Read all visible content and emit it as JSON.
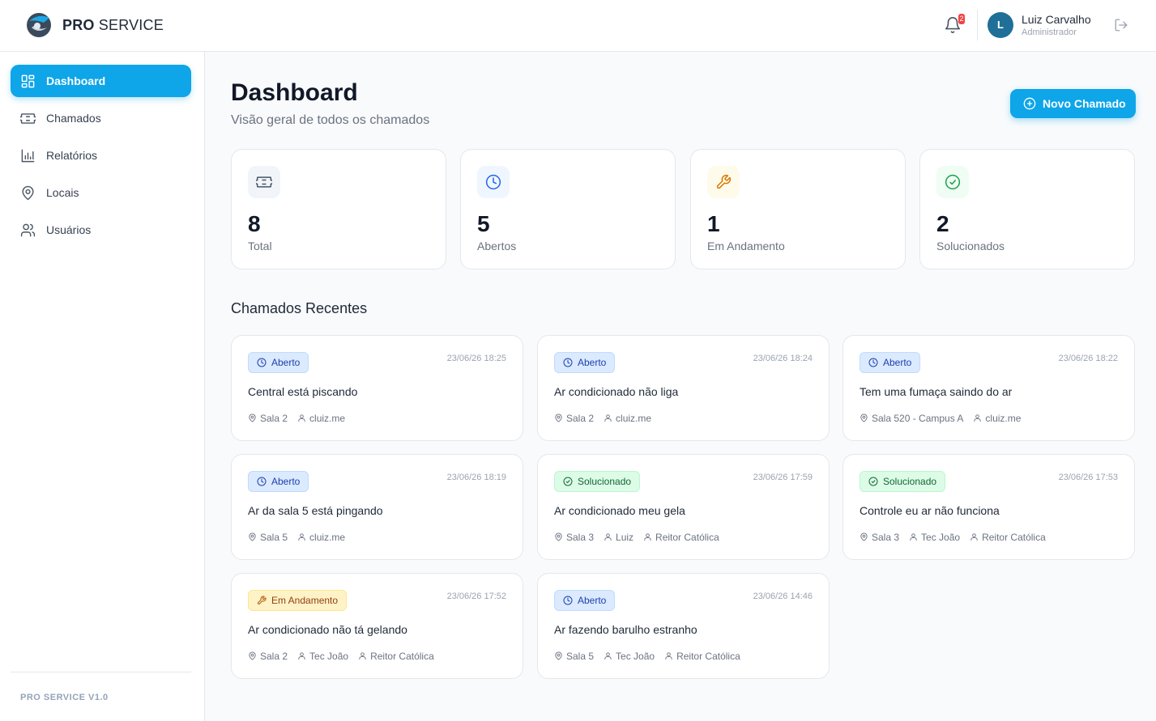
{
  "header": {
    "brand_bold": "PRO",
    "brand_rest": " SERVICE",
    "notification_count": "2",
    "user": {
      "initial": "L",
      "name": "Luiz Carvalho",
      "role": "Administrador"
    }
  },
  "sidebar": {
    "items": [
      {
        "label": "Dashboard",
        "icon": "grid-icon",
        "active": true
      },
      {
        "label": "Chamados",
        "icon": "ticket-icon"
      },
      {
        "label": "Relatórios",
        "icon": "bar-chart-icon"
      },
      {
        "label": "Locais",
        "icon": "map-pin-icon"
      },
      {
        "label": "Usuários",
        "icon": "users-icon"
      }
    ],
    "version": "PRO SERVICE V1.0"
  },
  "main": {
    "title": "Dashboard",
    "subtitle": "Visão geral de todos os chamados",
    "new_button": "Novo Chamado",
    "stats": [
      {
        "value": "8",
        "label": "Total",
        "icon": "ticket-icon",
        "color": "#475569"
      },
      {
        "value": "5",
        "label": "Abertos",
        "icon": "clock-icon",
        "color": "#2563eb"
      },
      {
        "value": "1",
        "label": "Em Andamento",
        "icon": "wrench-icon",
        "color": "#d97706"
      },
      {
        "value": "2",
        "label": "Solucionados",
        "icon": "check-circle-icon",
        "color": "#16a34a"
      }
    ],
    "recent_title": "Chamados Recentes",
    "tickets": [
      {
        "status": "Aberto",
        "date": "23/06/26 18:25",
        "title": "Central está piscando",
        "location": "Sala 2",
        "user": "cluiz.me",
        "tech": ""
      },
      {
        "status": "Aberto",
        "date": "23/06/26 18:24",
        "title": "Ar condicionado não liga",
        "location": "Sala 2",
        "user": "cluiz.me",
        "tech": ""
      },
      {
        "status": "Aberto",
        "date": "23/06/26 18:22",
        "title": "Tem uma fumaça saindo do ar",
        "location": "Sala 520 - Campus A",
        "user": "cluiz.me",
        "tech": ""
      },
      {
        "status": "Aberto",
        "date": "23/06/26 18:19",
        "title": "Ar da sala 5 está pingando",
        "location": "Sala 5",
        "user": "cluiz.me",
        "tech": ""
      },
      {
        "status": "Solucionado",
        "date": "23/06/26 17:59",
        "title": "Ar condicionado meu gela",
        "location": "Sala 3",
        "user": "Luiz",
        "tech": "Reitor Católica"
      },
      {
        "status": "Solucionado",
        "date": "23/06/26 17:53",
        "title": "Controle eu ar não funciona",
        "location": "Sala 3",
        "user": "Tec João",
        "tech": "Reitor Católica"
      },
      {
        "status": "Em Andamento",
        "date": "23/06/26 17:52",
        "title": "Ar condicionado não tá gelando",
        "location": "Sala 2",
        "user": "Tec João",
        "tech": "Reitor Católica"
      },
      {
        "status": "Aberto",
        "date": "23/06/26 14:46",
        "title": "Ar fazendo barulho estranho",
        "location": "Sala 5",
        "user": "Tec João",
        "tech": "Reitor Católica"
      }
    ]
  },
  "colors": {
    "accent": "#0ea5e9",
    "aberto": "#1e40af",
    "solucionado": "#166534",
    "andamento": "#92400e"
  }
}
